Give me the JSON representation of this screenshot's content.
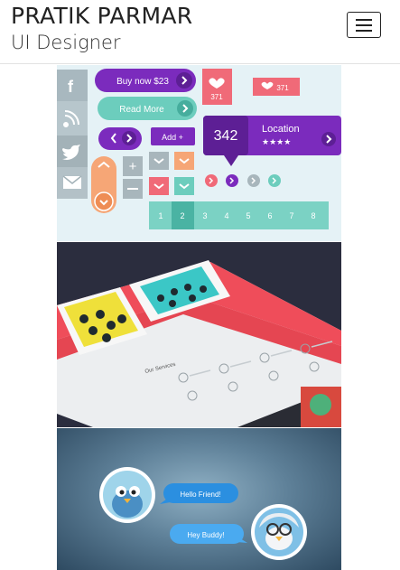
{
  "header": {
    "brand_name": "PRATIK PARMAR",
    "brand_role": "UI Designer",
    "menu_icon": "hamburger-icon"
  },
  "portfolio": {
    "ui_kit": {
      "buy_now_label": "Buy now $23",
      "read_more_label": "Read More",
      "add_label": "Add +",
      "like_count_1": "371",
      "like_count_2": "371",
      "location_count": "342",
      "location_label": "Location",
      "location_stars": "★★★★",
      "pagination": [
        "1",
        "2",
        "3",
        "4",
        "5",
        "6",
        "7",
        "8"
      ],
      "social_icons": [
        "facebook-icon",
        "rss-icon",
        "twitter-icon",
        "mail-icon"
      ],
      "colors": {
        "purple": "#7b2bbd",
        "teal": "#6ccdbd",
        "coral": "#f06a78",
        "orange": "#f6a676",
        "gray": "#a8b6bc"
      }
    },
    "services_mockup": {
      "section_title": "Our Services"
    },
    "chat_bubbles": {
      "message_1": "Hello Friend!",
      "message_2": "Hey Buddy!"
    }
  }
}
